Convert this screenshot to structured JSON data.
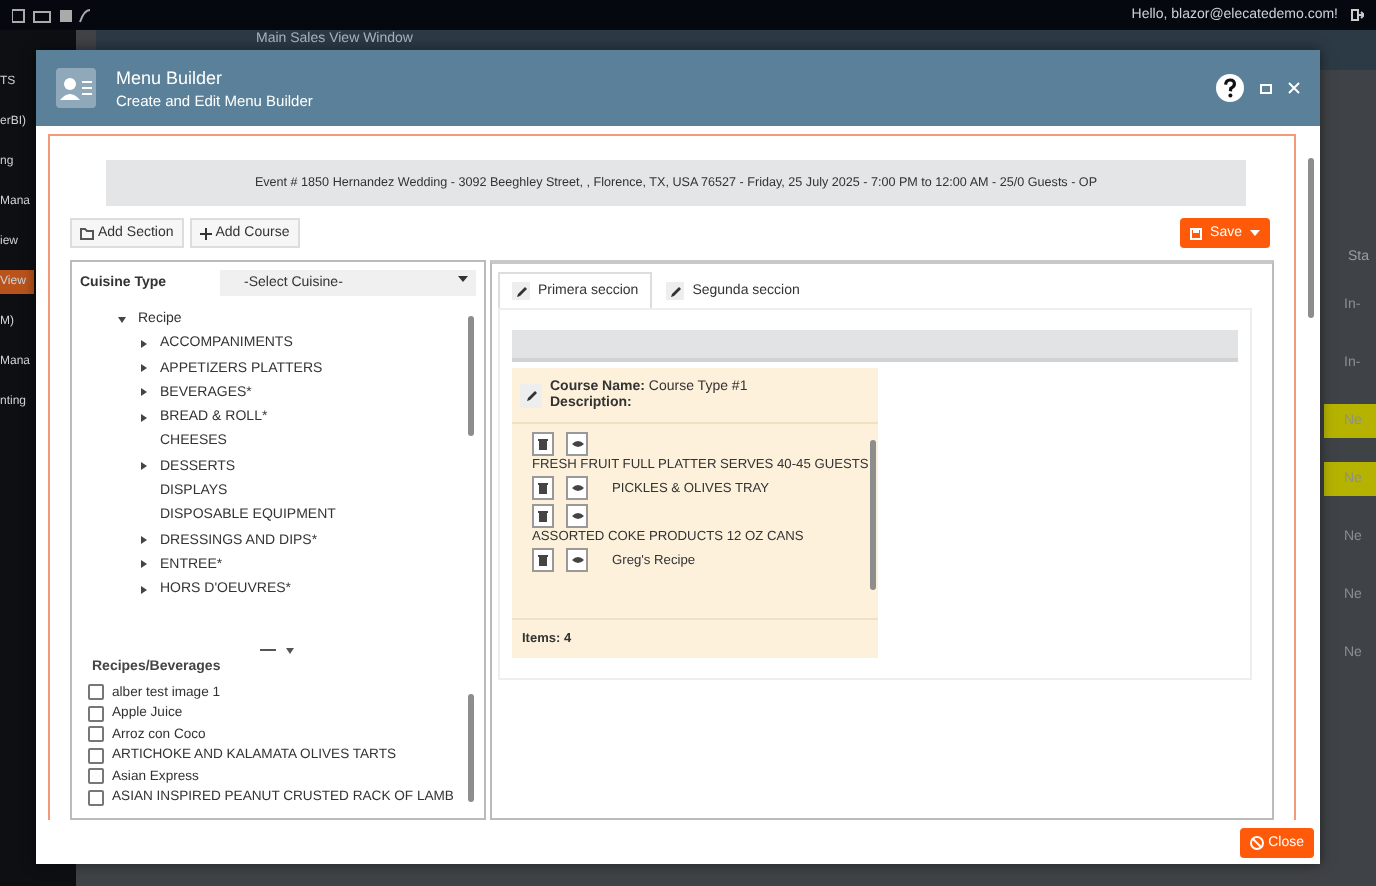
{
  "app": {
    "user_greeting": "Hello, blazor@elecatedemo.com!",
    "page_title": "Main Sales View Window",
    "sidebar_items": [
      {
        "label": "TS",
        "selected": false
      },
      {
        "label": "erBI)",
        "selected": false
      },
      {
        "label": "ng",
        "selected": false
      },
      {
        "label": "Mana",
        "selected": false
      },
      {
        "label": "iew",
        "selected": false
      },
      {
        "label": "View",
        "selected": true
      },
      {
        "label": "M)",
        "selected": false
      },
      {
        "label": "Mana",
        "selected": false
      },
      {
        "label": "nting",
        "selected": false
      }
    ],
    "right_column": {
      "header": "Sta",
      "cells": [
        {
          "text": "In-",
          "highlighted": false
        },
        {
          "text": "In-",
          "highlighted": false
        },
        {
          "text": "Ne",
          "highlighted": true
        },
        {
          "text": "Ne",
          "highlighted": true
        },
        {
          "text": "Ne",
          "highlighted": false
        },
        {
          "text": "Ne",
          "highlighted": false
        },
        {
          "text": "Ne",
          "highlighted": false
        }
      ]
    }
  },
  "dialog": {
    "title": "Menu Builder",
    "subtitle": "Create and Edit Menu Builder",
    "event_info": "Event # 1850 Hernandez Wedding - 3092 Beeghley Street, , Florence, TX, USA 76527 - Friday, 25 July 2025 - 7:00 PM to 12:00 AM - 25/0 Guests - OP",
    "toolbar": [
      {
        "kind": "section",
        "label": "Add Section"
      },
      {
        "kind": "course",
        "label": "Add Course"
      }
    ],
    "save_button": "Save",
    "cuisine_label": "Cuisine Type",
    "cuisine_select": "-Select Cuisine-",
    "tree": {
      "label": "Recipe",
      "expanded": true,
      "children": [
        {
          "label": "ACCOMPANIMENTS",
          "kind": "folder"
        },
        {
          "label": "APPETIZERS PLATTERS",
          "kind": "folder"
        },
        {
          "label": "BEVERAGES*",
          "kind": "folder"
        },
        {
          "label": "BREAD & ROLL*",
          "kind": "folder"
        },
        {
          "label": "CHEESES",
          "kind": "leaf"
        },
        {
          "label": "DESSERTS",
          "kind": "folder"
        },
        {
          "label": "DISPLAYS",
          "kind": "leaf"
        },
        {
          "label": "DISPOSABLE EQUIPMENT",
          "kind": "leaf"
        },
        {
          "label": "DRESSINGS AND DIPS*",
          "kind": "folder"
        },
        {
          "label": "ENTREE*",
          "kind": "folder"
        },
        {
          "label": "HORS D'OEUVRES*",
          "kind": "folder"
        }
      ]
    },
    "recipes_title": "Recipes/Beverages",
    "recipes": [
      {
        "label": "alber test image 1",
        "checked": false
      },
      {
        "label": "Apple Juice",
        "checked": false
      },
      {
        "label": "Arroz con Coco",
        "checked": false
      },
      {
        "label": "ARTICHOKE AND KALAMATA OLIVES TARTS",
        "checked": false
      },
      {
        "label": "Asian Express",
        "checked": false
      },
      {
        "label": "ASIAN INSPIRED PEANUT CRUSTED RACK OF LAMB",
        "checked": false
      }
    ],
    "tabs": [
      {
        "label": "Primera seccion",
        "selected": true
      },
      {
        "label": "Segunda seccion",
        "selected": false
      }
    ],
    "course": {
      "name_label": "Course Name:",
      "name": "Course Type #1",
      "description_label": "Description:",
      "items": [
        {
          "name": "FRESH FRUIT FULL PLATTER SERVES 40-45 GUESTS"
        },
        {
          "name": "PICKLES & OLIVES TRAY"
        },
        {
          "name": "ASSORTED COKE PRODUCTS 12 OZ CANS"
        },
        {
          "name": "Greg's Recipe"
        }
      ],
      "count_label": "Items:",
      "count": "4"
    },
    "close_button": "Close"
  }
}
